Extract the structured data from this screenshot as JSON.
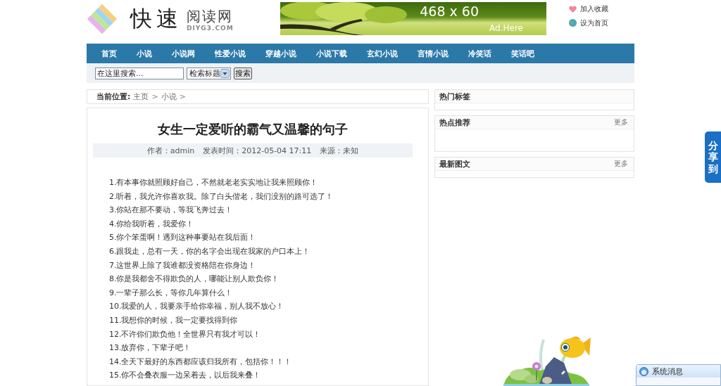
{
  "header": {
    "logo": {
      "title": "快速",
      "subtitle": "阅读网",
      "domain": "DIYG3.COM"
    },
    "ad_banner": {
      "size_label": "468 x 60",
      "caption": "Ad.Here"
    },
    "links": [
      {
        "kind": "bookmark",
        "label": "加入收藏"
      },
      {
        "kind": "homepage",
        "label": "设为首页"
      }
    ]
  },
  "nav": [
    "首页",
    "小说",
    "小说网",
    "性爱小说",
    "穿越小说",
    "小说下载",
    "玄幻小说",
    "言情小说",
    "冷笑话",
    "笑话吧"
  ],
  "search": {
    "value": "在这里搜索...",
    "select": "检索标题",
    "button": "搜索"
  },
  "breadcrumb": {
    "label": "当前位置:",
    "trail": [
      {
        "kind": "link",
        "text": "主页"
      },
      {
        "kind": "separator",
        "text": ">"
      },
      {
        "kind": "link",
        "text": "小说"
      },
      {
        "kind": "separator",
        "text": ">"
      }
    ]
  },
  "article": {
    "title": "女生一定爱听的霸气又温馨的句子",
    "meta": [
      "作者：admin",
      "发表时间：2012-05-04 17:11",
      "来源：未知"
    ],
    "lines": [
      "1.有本事你就照顾好自己，不然就老老实实地让我来照顾你！",
      "2.听着，我允许你喜欢我。除了白头偕老，我们没别的路可选了！",
      "3.你站在那不要动，等我飞奔过去！",
      "4.你给我听着，我爱你！",
      "5.你个笨蛋啊！遇到这种事要站在我后面！",
      "6.跟我走，总有一天，你的名字会出现在我家的户口本上！",
      "7.这世界上除了我谁都没资格陪在你身边！",
      "8.你是我都舍不得欺负的人，哪能让别人欺负你！",
      "9.一辈子那么长，等你几年算什么！",
      "10.我爱的人，我要亲手给你幸福，别人我不放心！",
      "11.我想你的时候，我一定要找得到你",
      "12.不许你们欺负他！全世界只有我才可以！",
      "13.放弃你，下辈子吧！",
      "14.全天下最好的东西都应该归我所有，包括你！！！",
      "15.你不会叠衣服一边呆着去，以后我来叠！"
    ]
  },
  "sidebar": [
    {
      "kind": "tags",
      "title": "热门标签"
    },
    {
      "kind": "list",
      "title": "热点推荐",
      "more": "更多"
    },
    {
      "kind": "gallery",
      "title": "最新图文",
      "more": "更多"
    }
  ],
  "share_tab": {
    "label": "分享到"
  },
  "popup": {
    "title": "系统消息"
  }
}
